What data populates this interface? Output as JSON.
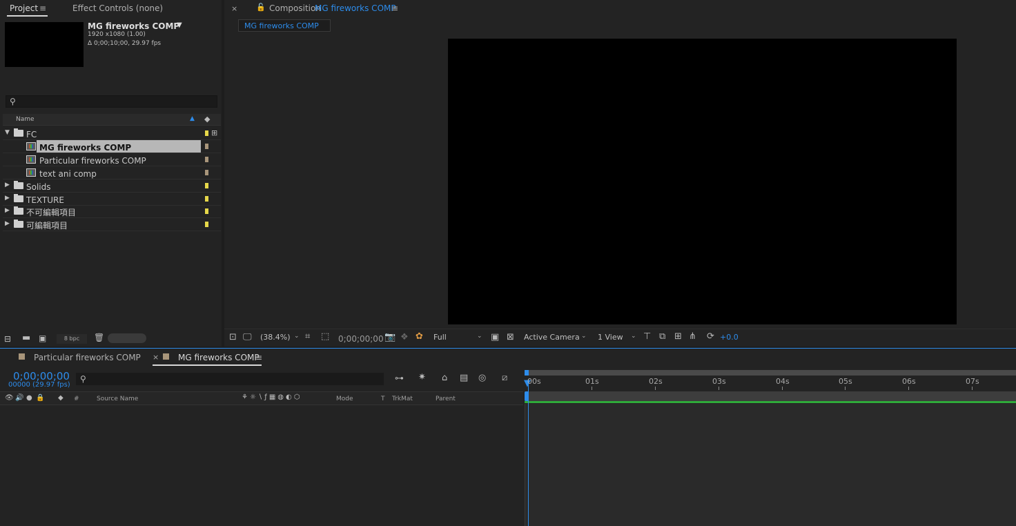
{
  "project_panel": {
    "tabs": [
      "Project",
      "Effect Controls (none)"
    ],
    "selected_item": {
      "name": "MG fireworks COMP",
      "resolution": "1920 x1080 (1.00)",
      "duration": "Δ 0;00;10;00, 29.97 fps"
    },
    "search_placeholder": "",
    "column_name": "Name",
    "items": [
      {
        "name": "FC",
        "type": "folder",
        "expanded": true,
        "label_color": "#e6d84a"
      },
      {
        "name": "MG fireworks COMP",
        "type": "comp",
        "selected": true,
        "label_color": "#a8957a"
      },
      {
        "name": "Particular fireworks COMP",
        "type": "comp",
        "label_color": "#a8957a"
      },
      {
        "name": "text ani comp",
        "type": "comp",
        "label_color": "#a8957a"
      },
      {
        "name": "Solids",
        "type": "folder",
        "expanded": false,
        "label_color": "#e6d84a"
      },
      {
        "name": "TEXTURE",
        "type": "folder",
        "expanded": false,
        "label_color": "#e6d84a"
      },
      {
        "name": "不可編輯項目",
        "type": "folder",
        "expanded": false,
        "label_color": "#e6d84a"
      },
      {
        "name": "可編輯項目",
        "type": "folder",
        "expanded": false,
        "label_color": "#e6d84a"
      }
    ],
    "bpc": "8 bpc"
  },
  "composition_panel": {
    "title_prefix": "Composition",
    "comp_name": "MG fireworks COMP",
    "flow_tab": "MG fireworks COMP",
    "zoom": "(38.4%)",
    "timecode": "0;00;00;00",
    "resolution": "Full",
    "camera": "Active Camera",
    "views": "1 View",
    "exposure": "+0.0"
  },
  "timeline": {
    "tabs": [
      "Particular fireworks COMP",
      "MG fireworks COMP"
    ],
    "current_time": "0;00;00;00",
    "frame_info": "00000 (29.97 fps)",
    "ruler": [
      "00s",
      "01s",
      "02s",
      "03s",
      "04s",
      "05s",
      "06s",
      "07s"
    ],
    "columns": {
      "hash": "#",
      "source_name": "Source Name",
      "mode": "Mode",
      "t": "T",
      "trkmat": "TrkMat",
      "parent": "Parent"
    }
  },
  "colors": {
    "accent_blue": "#2d8ceb",
    "work_area_green": "#2faa3a",
    "folder_label": "#e6d84a",
    "comp_label": "#a8957a"
  }
}
